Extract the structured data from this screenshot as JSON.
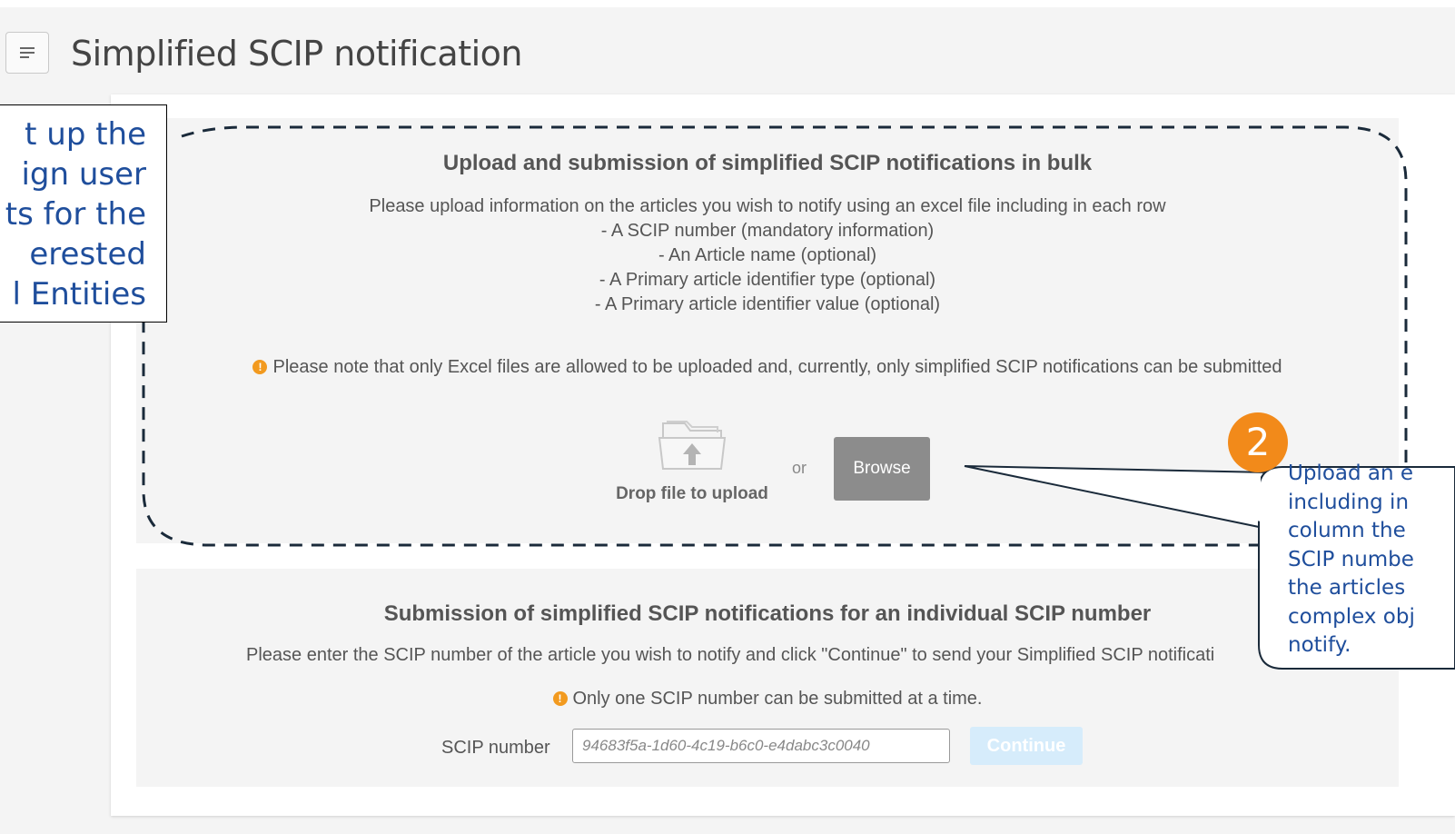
{
  "header": {
    "menu_icon": "menu-icon",
    "title": "Simplified SCIP notification"
  },
  "bulk": {
    "title": "Upload and submission of simplified SCIP notifications in bulk",
    "description": [
      "Please upload information on the articles you wish to notify using an excel file including in each row",
      "- A SCIP number (mandatory information)",
      "- An Article name (optional)",
      "- A Primary article identifier type (optional)",
      "- A Primary article identifier value (optional)"
    ],
    "warning_icon": "!",
    "warning": "Please note that only Excel files are allowed to be uploaded and, currently, only simplified SCIP notifications can be submitted",
    "drop_label": "Drop file to upload",
    "or": "or",
    "browse_label": "Browse"
  },
  "single": {
    "title": "Submission of simplified SCIP notifications for an individual SCIP number",
    "description": "Please enter the SCIP number of the article you wish to notify and click \"Continue\" to send your Simplified SCIP notificati",
    "warning_icon": "!",
    "warning": "Only one SCIP number can be submitted at a time.",
    "scip_label": "SCIP number",
    "scip_placeholder": "94683f5a-1d60-4c19-b6c0-e4dabc3c0040",
    "continue_label": "Continue"
  },
  "annotations": {
    "left_note_lines": [
      "t up the",
      "ign user",
      "ts for the",
      "erested",
      "l Entities"
    ],
    "step_number": "2",
    "callout_lines": [
      "Upload an e",
      "including in",
      "column the",
      "SCIP numbe",
      "the articles",
      "complex obj",
      "notify."
    ],
    "colors": {
      "note_text": "#1f4e9c",
      "badge": "#f28a1a",
      "dashed_border": "#1a2a3a"
    }
  }
}
